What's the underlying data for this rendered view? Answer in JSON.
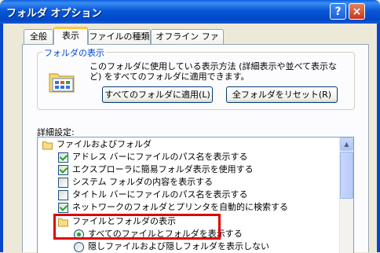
{
  "window": {
    "title": "フォルダ オプション",
    "help_label": "?",
    "close_label": "×"
  },
  "tabs": [
    {
      "label": "全般"
    },
    {
      "label": "表示"
    },
    {
      "label": "ファイルの種類"
    },
    {
      "label": "オフライン ファイル"
    }
  ],
  "folder_views": {
    "group_label": "フォルダの表示",
    "description": "このフォルダに使用している表示方法 (詳細表示や並べて表示など) をすべてのフォルダに適用できます。",
    "apply_button": "すべてのフォルダに適用(L)",
    "reset_button": "全フォルダをリセット(R)"
  },
  "advanced": {
    "label": "詳細設定:",
    "items": [
      {
        "type": "folder",
        "text": "ファイルおよびフォルダ"
      },
      {
        "type": "checkbox",
        "checked": true,
        "text": "アドレス バーにファイルのパス名を表示する"
      },
      {
        "type": "checkbox",
        "checked": true,
        "text": "エクスプローラに簡易フォルダ表示を使用する"
      },
      {
        "type": "checkbox",
        "checked": false,
        "text": "システム フォルダの内容を表示する"
      },
      {
        "type": "checkbox",
        "checked": false,
        "text": "タイトル バーにファイルのパス名を表示する"
      },
      {
        "type": "checkbox",
        "checked": true,
        "text": "ネットワークのフォルダとプリンタを自動的に検索する"
      },
      {
        "type": "folder",
        "text": "ファイルとフォルダの表示"
      },
      {
        "type": "radio",
        "selected": true,
        "text": "すべてのファイルとフォルダを表示する"
      },
      {
        "type": "radio",
        "selected": false,
        "text": "隠しファイルおよび隠しフォルダを表示しない"
      }
    ],
    "scroll_up": "▲"
  },
  "colors": {
    "highlight": "#e00000",
    "check": "#21a121"
  }
}
